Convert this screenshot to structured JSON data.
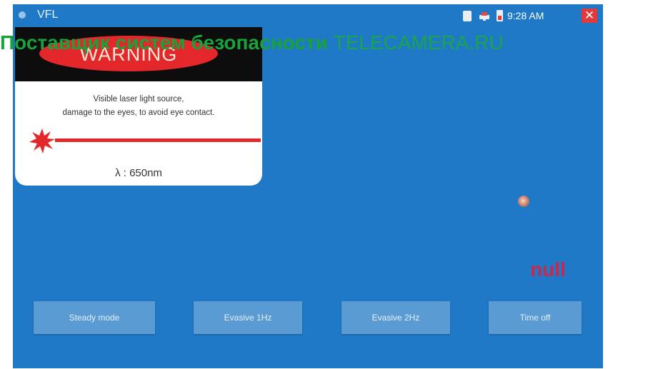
{
  "window": {
    "title": "VFL",
    "clock": "9:28 AM",
    "close_glyph": "✕",
    "icons": [
      "app-icon",
      "sd-card-icon",
      "network-icon",
      "battery-icon",
      "close-icon"
    ]
  },
  "warning": {
    "heading": "WARNING",
    "message_line1": "Visible laser light source,",
    "message_line2": "damage to the eyes, to avoid eye contact.",
    "wavelength": "λ : 650nm"
  },
  "indicator": {
    "status_text": "null"
  },
  "modes": {
    "steady": "Steady mode",
    "evasive_1hz": "Evasive 1Hz",
    "evasive_2hz": "Evasive 2Hz",
    "time_off": "Time off"
  },
  "watermark": {
    "ru_text": "Поставщик систем безопасности",
    "site": "TELECAMERA.RU"
  },
  "colors": {
    "screen_bg": "#1f79c7",
    "button_bg": "#5b9bd3",
    "warning_red": "#e3272b",
    "null_text": "#c62a4f",
    "watermark_green": "#17a23a"
  }
}
